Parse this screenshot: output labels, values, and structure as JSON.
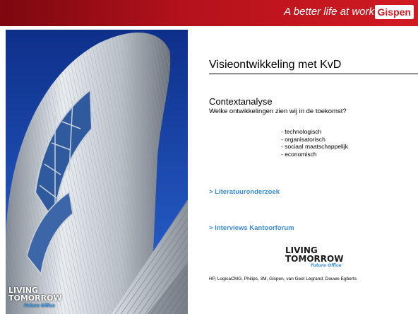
{
  "header": {
    "tagline": "A better life at work",
    "brand": "Gispen"
  },
  "photo": {
    "logo_line1": "LIVING",
    "logo_line2": "TOMORROW",
    "logo_sub": "Future Office"
  },
  "slide": {
    "title": "Visieontwikkeling met KvD",
    "subtitle": "Contextanalyse",
    "question": "Welke ontwikkelingen zien wij in de toekomst?",
    "bullets": [
      "- technologisch",
      "- organisatorisch",
      "- sociaal maatschappelijk",
      "- economisch"
    ],
    "links": [
      "> Literatuuronderzoek",
      "> Interviews Kantoorforum"
    ],
    "logo_line1": "LIVING",
    "logo_line2": "TOMORROW",
    "logo_sub": "Future Office",
    "partners": "HP, LogicaCMG, Philips, 3M, Gispen, van Geel Legrand, Douwe Egberts"
  },
  "colors": {
    "header_red": "#d11a22",
    "link_blue": "#3b8be0",
    "sky_blue": "#1b4bb0"
  }
}
